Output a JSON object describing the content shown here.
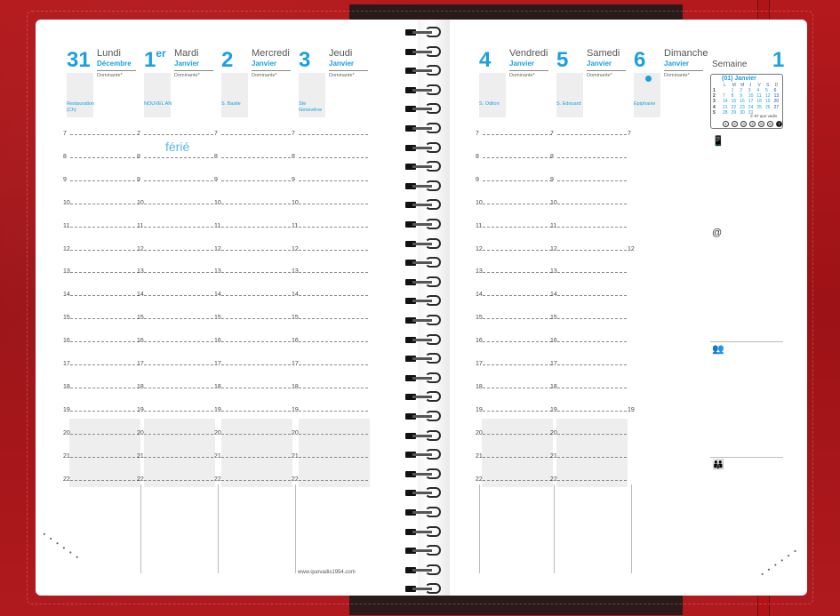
{
  "left_days": [
    {
      "num": "31",
      "sup": "",
      "name": "Lundi",
      "month": "Décembre",
      "dominante": "Dominante*",
      "saint": "Restauration (Ch)"
    },
    {
      "num": "1",
      "sup": "er",
      "name": "Mardi",
      "month": "Janvier",
      "dominante": "Dominante*",
      "saint": "NOUVEL AN"
    },
    {
      "num": "2",
      "sup": "",
      "name": "Mercredi",
      "month": "Janvier",
      "dominante": "Dominante*",
      "saint": "S. Basile"
    },
    {
      "num": "3",
      "sup": "",
      "name": "Jeudi",
      "month": "Janvier",
      "dominante": "Dominante*",
      "saint": "Ste Geneviève"
    }
  ],
  "right_days": [
    {
      "num": "4",
      "sup": "",
      "name": "Vendredi",
      "month": "Janvier",
      "dominante": "Dominante*",
      "saint": "S. Odilon"
    },
    {
      "num": "5",
      "sup": "",
      "name": "Samedi",
      "month": "Janvier",
      "dominante": "Dominante*",
      "saint": "S. Edouard"
    },
    {
      "num": "6",
      "sup": "",
      "name": "Dimanche",
      "month": "Janvier",
      "dominante": "Dominante*",
      "saint": "Epiphanie"
    }
  ],
  "hours": [
    "7",
    "8",
    "9",
    "10",
    "11",
    "12",
    "13",
    "14",
    "15",
    "16",
    "17",
    "18",
    "19",
    "20",
    "21",
    "22"
  ],
  "ferie": "férié",
  "url": "www.quovadis1954.com",
  "week": {
    "label": "Semaine",
    "number": "1"
  },
  "mini_calendar": {
    "title": "(01) Janvier",
    "headers": [
      "L",
      "M",
      "M",
      "J",
      "V",
      "S",
      "D"
    ],
    "weeks": [
      {
        "wk": "1",
        "days": [
          "",
          "1",
          "2",
          "3",
          "4",
          "5",
          "6"
        ]
      },
      {
        "wk": "2",
        "days": [
          "7",
          "8",
          "9",
          "10",
          "11",
          "12",
          "13"
        ]
      },
      {
        "wk": "3",
        "days": [
          "14",
          "15",
          "16",
          "17",
          "18",
          "19",
          "20"
        ]
      },
      {
        "wk": "4",
        "days": [
          "21",
          "22",
          "23",
          "24",
          "25",
          "26",
          "27"
        ]
      },
      {
        "wk": "5",
        "days": [
          "28",
          "29",
          "30",
          "31",
          "",
          "",
          ""
        ]
      }
    ],
    "copyright": "© 87 quo vadis",
    "weekday_circles": [
      "1",
      "2",
      "3",
      "4",
      "5",
      "6",
      "7"
    ]
  },
  "note_icons": {
    "phone": "📱",
    "at": "@",
    "people": "👥",
    "family": "👪"
  }
}
